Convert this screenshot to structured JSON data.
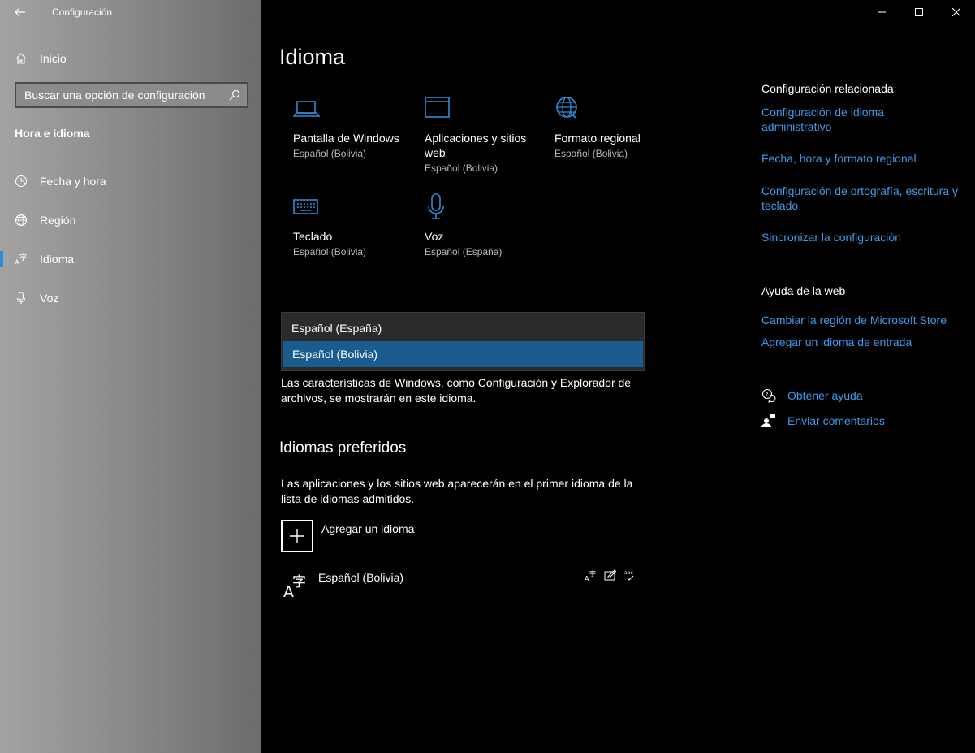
{
  "window": {
    "title": "Configuración"
  },
  "sidebar": {
    "home": "Inicio",
    "search_placeholder": "Buscar una opción de configuración",
    "section": "Hora e idioma",
    "items": [
      {
        "label": "Fecha y hora",
        "icon": "clock-icon"
      },
      {
        "label": "Región",
        "icon": "globe-icon"
      },
      {
        "label": "Idioma",
        "icon": "language-icon",
        "selected": true
      },
      {
        "label": "Voz",
        "icon": "microphone-icon"
      }
    ]
  },
  "main": {
    "title": "Idioma",
    "tiles": [
      {
        "title": "Pantalla de Windows",
        "sub": "Español (Bolivia)"
      },
      {
        "title": "Aplicaciones y sitios web",
        "sub": "Español (Bolivia)"
      },
      {
        "title": "Formato regional",
        "sub": "Español (Bolivia)"
      },
      {
        "title": "Teclado",
        "sub": "Español (Bolivia)"
      },
      {
        "title": "Voz",
        "sub": "Español (España)"
      }
    ],
    "dropdown": {
      "options": [
        "Español (España)",
        "Español (Bolivia)"
      ],
      "selected": "Español (Bolivia)"
    },
    "display_desc": "Las características de Windows, como Configuración y Explorador de archivos, se mostrarán en este idioma.",
    "preferred_title": "Idiomas preferidos",
    "preferred_desc": "Las aplicaciones y los sitios web aparecerán en el primer idioma de la lista de idiomas admitidos.",
    "add_language": "Agregar un idioma",
    "languages": [
      {
        "name": "Español (Bolivia)"
      }
    ]
  },
  "related": {
    "title": "Configuración relacionada",
    "links": [
      "Configuración de idioma administrativo",
      "Fecha, hora y formato regional",
      "Configuración de ortografía, escritura y teclado",
      "Sincronizar la configuración"
    ]
  },
  "web_help": {
    "title": "Ayuda de la web",
    "links": [
      "Cambiar la región de Microsoft Store",
      "Agregar un idioma de entrada"
    ]
  },
  "help": {
    "get_help": "Obtener ayuda",
    "feedback": "Enviar comentarios"
  },
  "colors": {
    "accent": "#3f9ae8",
    "selected_bg": "#1b5c8f",
    "nav_indicator": "#2f8bd6"
  }
}
